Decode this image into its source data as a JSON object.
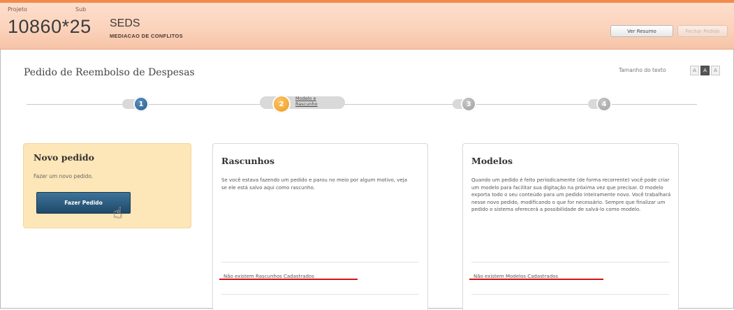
{
  "header": {
    "project_label": "Projeto",
    "sub_label": "Sub",
    "project_number": "10860*25",
    "org": "SEDS",
    "subtitle": "MEDIACAO DE CONFLITOS",
    "buttons": {
      "ver_resumo": "Ver Resumo",
      "fechar_pedido": "Fechar Pedido"
    }
  },
  "text_size": {
    "label": "Tamanho do texto",
    "options": [
      "A",
      "A",
      "A"
    ],
    "selected_index": 1
  },
  "page": {
    "title": "Pedido de Reembolso de Despesas"
  },
  "steps": [
    {
      "number": "1",
      "state": "done",
      "label": ""
    },
    {
      "number": "2",
      "state": "current",
      "label_line1": "Modelo e",
      "label_line2": "Rascunho"
    },
    {
      "number": "3",
      "state": "future",
      "label": ""
    },
    {
      "number": "4",
      "state": "future",
      "label": ""
    }
  ],
  "novo_pedido": {
    "title": "Novo pedido",
    "description": "Fazer um novo pedido.",
    "button": "Fazer Pedido"
  },
  "rascunhos": {
    "title": "Rascunhos",
    "description": "Se você estava fazendo um pedido e parou no meio por algum motivo, veja se ele está salvo aqui como rascunho.",
    "empty_message": "Não existem Rascunhos Cadastrados"
  },
  "modelos": {
    "title": "Modelos",
    "description": "Quando um pedido é feito periodicamente (de forma recorrente) você pode criar um modelo para facilitar sua digitação na próxima vez que precisar. O modelo exporta todo o seu conteúdo para um pedido inteiramente novo. Você trabalhará nesse novo pedido, modificando o que for necessário. Sempre que finalizar um pedido o sistema oferecerá a possibilidade de salvá-lo como modelo.",
    "empty_message": "Não existem Modelos Cadastrados"
  },
  "colors": {
    "header_bg": "#fbd2bb",
    "accent_orange": "#f38a4b",
    "primary_button": "#2b5a7e",
    "novo_card_bg": "#fde6b8",
    "annotation_red": "#d21414"
  }
}
